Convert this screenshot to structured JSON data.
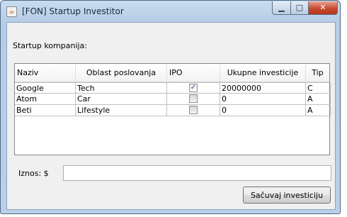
{
  "window": {
    "title": "[FON] Startup Investitor",
    "app_icon": "java-coffee-icon",
    "controls": {
      "minimize": "minimize-icon",
      "maximize": "maximize-icon",
      "close": "close-icon"
    }
  },
  "form": {
    "companies_label": "Startup kompanija:",
    "amount_label": "Iznos: $",
    "amount_value": "",
    "save_label": "Sačuvaj investiciju"
  },
  "table": {
    "columns": [
      "Naziv",
      "Oblast poslovanja",
      "IPO",
      "Ukupne investicije",
      "Tip"
    ],
    "rows": [
      {
        "naziv": "Google",
        "oblast": "Tech",
        "ipo": true,
        "investicije": "20000000",
        "tip": "C"
      },
      {
        "naziv": "Atom",
        "oblast": "Car",
        "ipo": false,
        "investicije": "0",
        "tip": "A"
      },
      {
        "naziv": "Beti",
        "oblast": "Lifestyle",
        "ipo": false,
        "investicije": "0",
        "tip": "A"
      }
    ]
  }
}
